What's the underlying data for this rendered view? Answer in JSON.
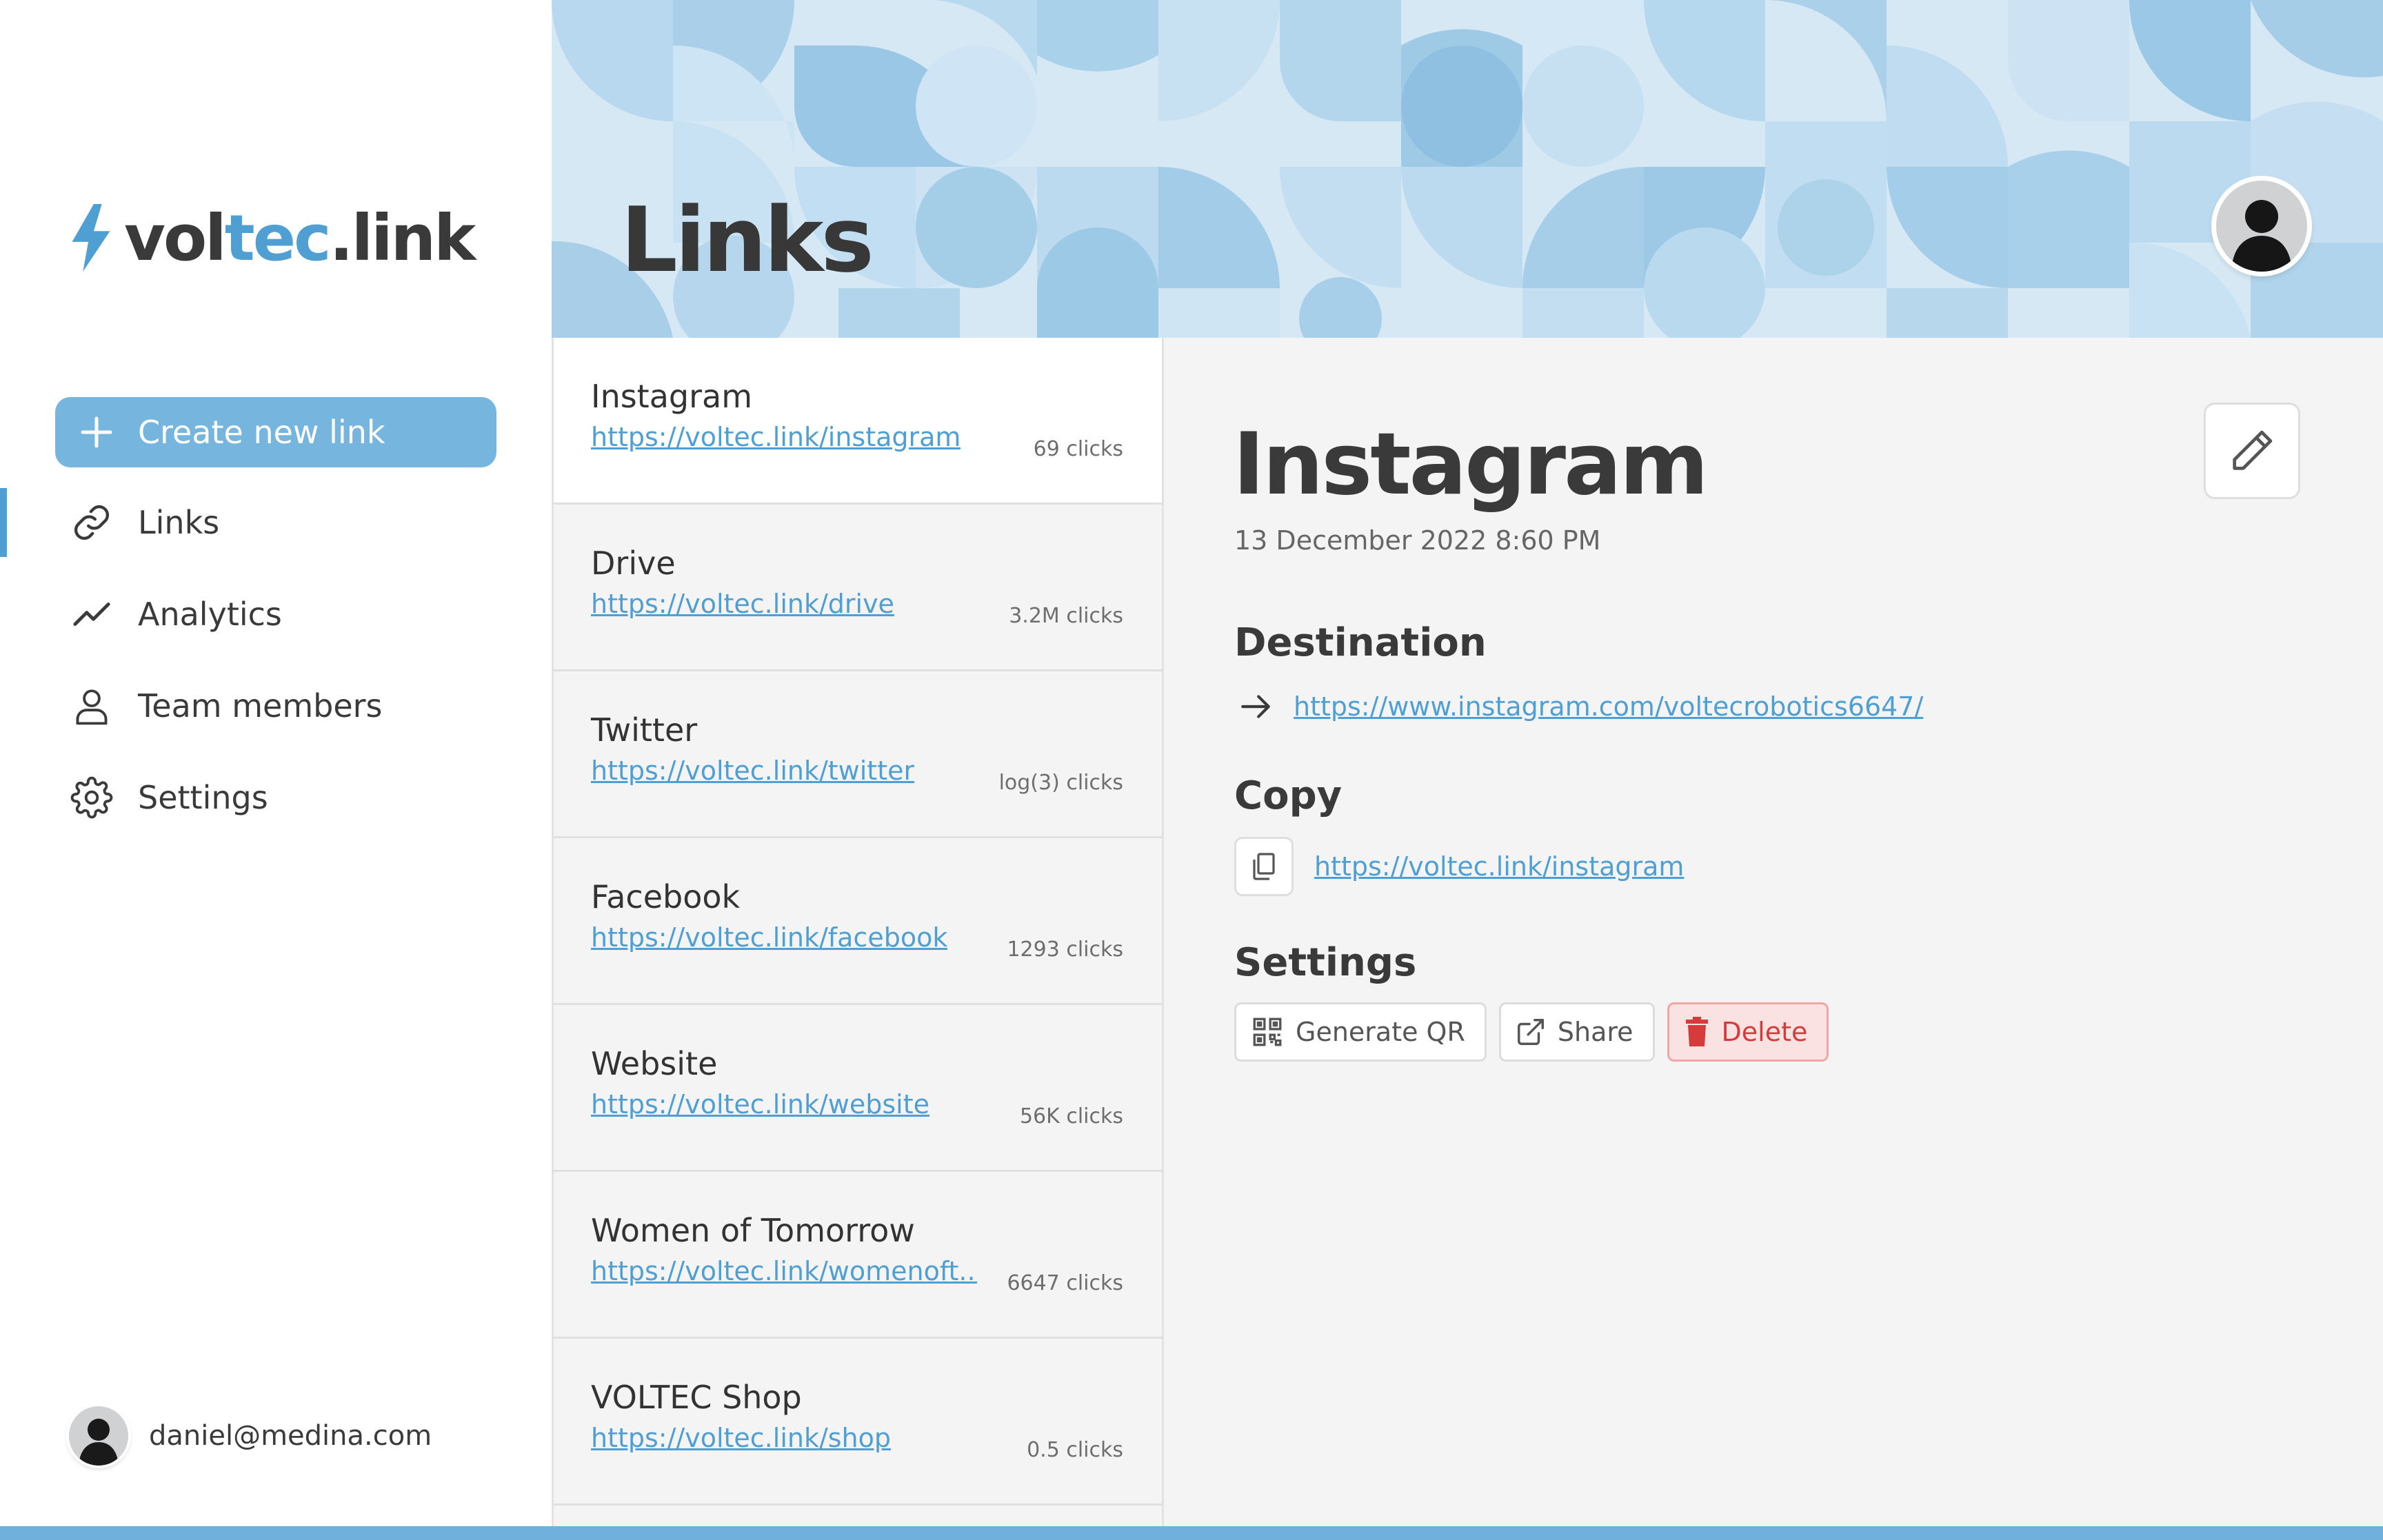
{
  "sidebar": {
    "brand": {
      "part1": "vol",
      "part2": "tec",
      "part3": ".link"
    },
    "create_label": "Create new link",
    "nav": [
      {
        "label": "Links",
        "icon": "link-icon",
        "active": true
      },
      {
        "label": "Analytics",
        "icon": "trend-icon",
        "active": false
      },
      {
        "label": "Team members",
        "icon": "user-icon",
        "active": false
      },
      {
        "label": "Settings",
        "icon": "gear-icon",
        "active": false
      }
    ],
    "user_email": "daniel@medina.com"
  },
  "header": {
    "title": "Links"
  },
  "links": [
    {
      "title": "Instagram",
      "url": "https://voltec.link/instagram",
      "clicks": "69 clicks",
      "selected": true
    },
    {
      "title": "Drive",
      "url": "https://voltec.link/drive",
      "clicks": "3.2M clicks"
    },
    {
      "title": "Twitter",
      "url": "https://voltec.link/twitter",
      "clicks": "log(3) clicks"
    },
    {
      "title": "Facebook",
      "url": "https://voltec.link/facebook",
      "clicks": "1293 clicks"
    },
    {
      "title": "Website",
      "url": "https://voltec.link/website",
      "clicks": "56K clicks"
    },
    {
      "title": "Women of Tomorrow",
      "url": "https://voltec.link/womenoft...",
      "clicks": "6647 clicks"
    },
    {
      "title": "VOLTEC Shop",
      "url": "https://voltec.link/shop",
      "clicks": "0.5 clicks"
    }
  ],
  "detail": {
    "title": "Instagram",
    "date": "13 December 2022 8:60 PM",
    "destination_heading": "Destination",
    "destination_url": "https://www.instagram.com/voltecrobotics6647/",
    "copy_heading": "Copy",
    "copy_url": "https://voltec.link/instagram",
    "settings_heading": "Settings",
    "buttons": {
      "qr": "Generate QR",
      "share": "Share",
      "delete": "Delete"
    }
  },
  "colors": {
    "accent": "#4f9fd3",
    "button": "#76b5dd",
    "danger": "#d63b3b",
    "danger_bg": "#fbe2e2",
    "panel_bg": "#f4f4f4"
  }
}
